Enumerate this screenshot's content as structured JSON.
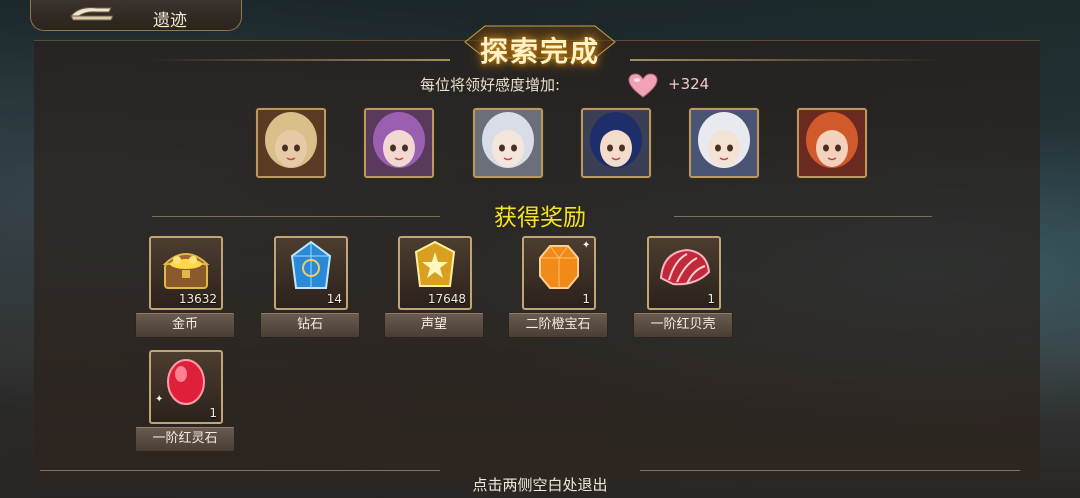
{
  "header": {
    "back_label": "遗迹"
  },
  "banner": {
    "title": "探索完成"
  },
  "favor": {
    "label": "每位将领好感度增加:",
    "value": "+324",
    "icon": "heart-icon"
  },
  "portraits": [
    {
      "name": "blonde-officer",
      "hair": "#d9c08a",
      "skin": "#e8c9a8",
      "bg": "#5a3a22"
    },
    {
      "name": "purple-hair-glasses",
      "hair": "#9a5fb0",
      "skin": "#f2d8d0",
      "bg": "#5a3a5a"
    },
    {
      "name": "silver-hair-ornament",
      "hair": "#d9dde8",
      "skin": "#f5e6dd",
      "bg": "#6a6f7a"
    },
    {
      "name": "navy-hair",
      "hair": "#1d2e6a",
      "skin": "#f3dccb",
      "bg": "#3a3f55"
    },
    {
      "name": "white-hair-cap",
      "hair": "#e8eaf0",
      "skin": "#f4e2d5",
      "bg": "#4a5575"
    },
    {
      "name": "red-hair",
      "hair": "#d05a2c",
      "skin": "#f2d2bd",
      "bg": "#6a2a20"
    }
  ],
  "rewards": {
    "title": "获得奖励",
    "items": [
      {
        "name": "金币",
        "count": "13632",
        "icon": "treasure-chest-icon"
      },
      {
        "name": "钻石",
        "count": "14",
        "icon": "blue-crystal-icon"
      },
      {
        "name": "声望",
        "count": "17648",
        "icon": "gold-medal-icon"
      },
      {
        "name": "二阶橙宝石",
        "count": "1",
        "icon": "orange-gem-icon"
      },
      {
        "name": "一阶红贝壳",
        "count": "1",
        "icon": "red-shell-icon"
      },
      {
        "name": "一阶红灵石",
        "count": "1",
        "icon": "red-spirit-stone-icon"
      }
    ]
  },
  "footer": {
    "hint": "点击两侧空白处退出"
  },
  "colors": {
    "title_glow": "#c88a1a",
    "reward_title": "#f3e42a",
    "frame_gold": "#bfa577"
  }
}
